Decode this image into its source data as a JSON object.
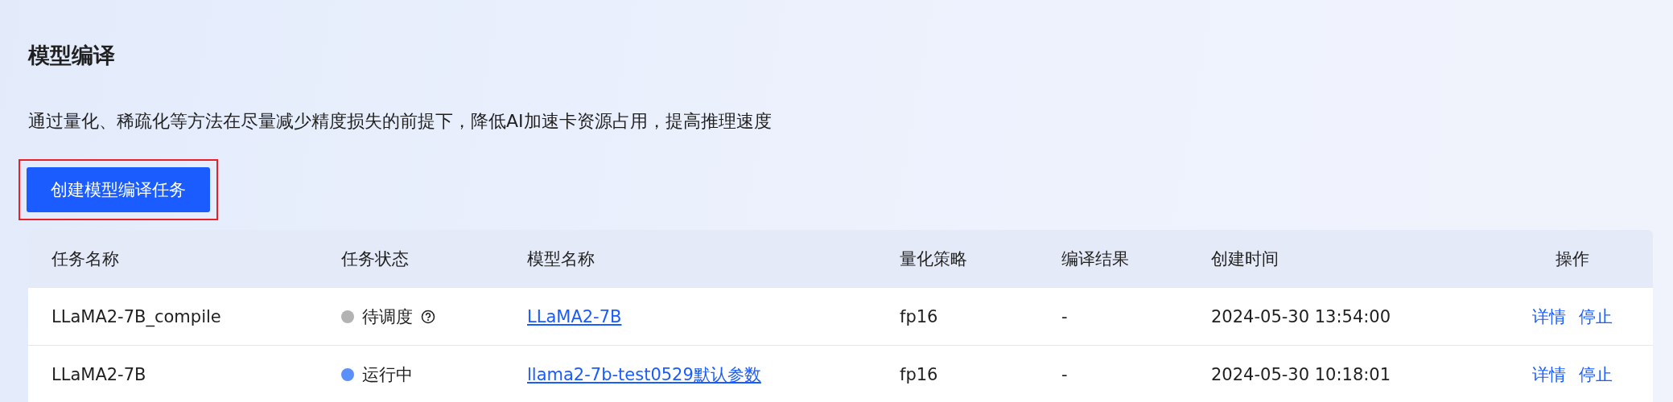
{
  "page": {
    "title": "模型编译",
    "description": "通过量化、稀疏化等方法在尽量减少精度损失的前提下，降低AI加速卡资源占用，提高推理速度"
  },
  "create_button": {
    "label": "创建模型编译任务",
    "highlighted": true
  },
  "table": {
    "columns": [
      "任务名称",
      "任务状态",
      "模型名称",
      "量化策略",
      "编译结果",
      "创建时间",
      "操作"
    ],
    "rows": [
      {
        "name": "LLaMA2-7B_compile",
        "status": "待调度",
        "color": "#b3b3b3",
        "status_help": true,
        "model": "LLaMA2-7B",
        "quantization": "fp16",
        "result": "-",
        "created": "2024-05-30 13:54:00",
        "actions": [
          "详情",
          "停止"
        ]
      },
      {
        "name": "LLaMA2-7B",
        "status": "运行中",
        "color": "#5b8ff9",
        "status_help": false,
        "model": "llama2-7b-test0529默认参数",
        "quantization": "fp16",
        "result": "-",
        "created": "2024-05-30 10:18:01",
        "actions": [
          "详情",
          "停止"
        ]
      }
    ]
  }
}
